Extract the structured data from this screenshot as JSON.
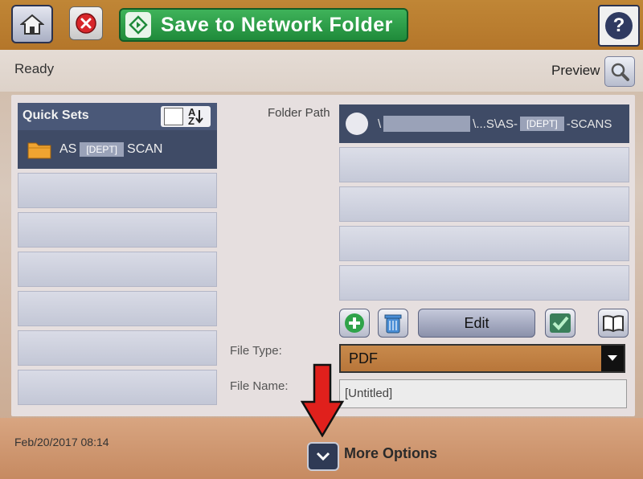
{
  "header": {
    "home_icon": "home-icon",
    "cancel_icon": "cancel-icon",
    "start_label": "Save to Network Folder",
    "start_icon": "start-diamond-icon",
    "help_icon": "help-icon",
    "help_symbol": "?"
  },
  "status": {
    "text": "Ready",
    "preview_label": "Preview",
    "preview_icon": "magnifier-icon"
  },
  "quick_sets": {
    "title": "Quick Sets",
    "sort_label": "A Z",
    "selected": {
      "prefix": "AS",
      "redacted": "[DEPT]",
      "suffix": "SCAN"
    },
    "empty_slots": 6
  },
  "folder_path": {
    "label": "Folder Path",
    "selected": {
      "prefix": "\\",
      "middle": "\\...S\\AS-",
      "redacted": "[DEPT]",
      "suffix": "-SCANS"
    },
    "empty_rows": 4
  },
  "actions": {
    "add_icon": "plus-icon",
    "delete_icon": "trash-icon",
    "edit_label": "Edit",
    "check_icon": "check-icon",
    "book_icon": "book-icon"
  },
  "file_type": {
    "label": "File Type:",
    "value": "PDF"
  },
  "file_name": {
    "label": "File Name:",
    "value": "[Untitled]"
  },
  "footer": {
    "datetime": "Feb/20/2017 08:14",
    "more_options_label": "More Options"
  },
  "colors": {
    "accent_orange": "#b8763a",
    "selected_row": "#3f4b66",
    "start_green": "#1f8a3a",
    "annotation_red": "#e0201c"
  }
}
